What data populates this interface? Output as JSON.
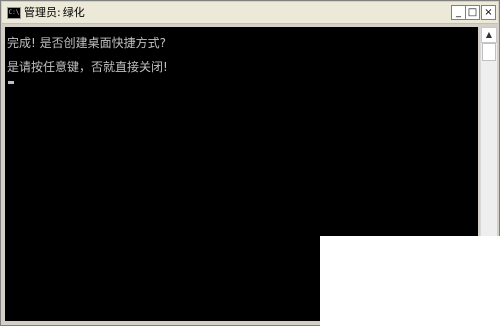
{
  "window": {
    "title_prefix": "管理员:",
    "title_name": "绿化",
    "icon_text": "C:\\",
    "icon_name": "console-icon",
    "controls": {
      "minimize": "_",
      "maximize": "□",
      "close": "×"
    }
  },
  "console": {
    "lines": [
      "完成! 是否创建桌面快捷方式?",
      "是请按任意键，否就直接关闭!"
    ],
    "colors": {
      "background": "#000000",
      "text": "#c0c0c0"
    }
  },
  "scrollbar": {
    "up_arrow": "▲"
  }
}
